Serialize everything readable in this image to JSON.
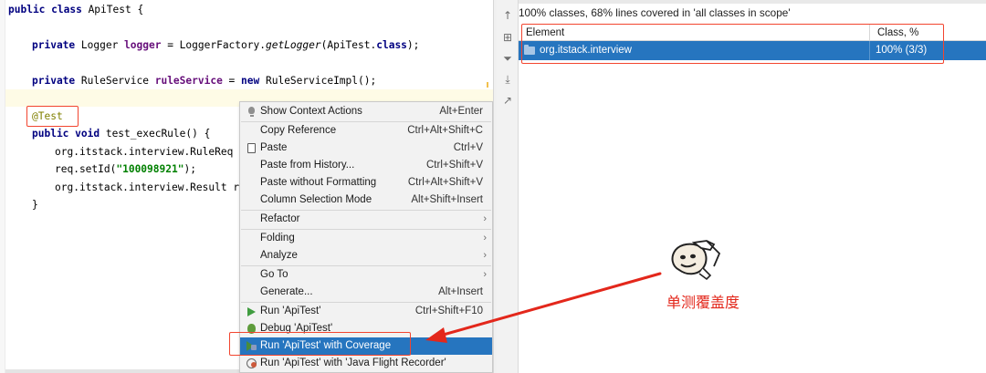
{
  "editor": {
    "code_lines": {
      "l1": {
        "kw": "public class",
        "rest": " ApiTest {"
      },
      "l2": {
        "kw": "private",
        "type": " Logger ",
        "field": "logger",
        "eq": " = LoggerFactory.",
        "method": "getLogger",
        "arg": "(ApiTest.",
        "kw2": "class",
        "end": ");"
      },
      "l3": {
        "kw": "private",
        "type": " RuleService ",
        "field": "ruleService",
        "eq": " = ",
        "kw2": "new",
        "rest": " RuleServiceImpl();"
      },
      "l4": {
        "annotation": "@Test"
      },
      "l5": {
        "kw": "public void",
        "rest": " test_execRule() {"
      },
      "l6": {
        "text": "org.itstack.interview.RuleReq req"
      },
      "l7": {
        "pre": "req.setId(",
        "str": "\"100098921\"",
        "post": ");"
      },
      "l8": {
        "text": "org.itstack.interview.Result resu"
      },
      "l9": {
        "text": "}"
      }
    }
  },
  "context_menu": {
    "items": [
      {
        "icon": "lightbulb-icon",
        "label": "Show Context Actions",
        "shortcut": "Alt+Enter"
      },
      {
        "icon": "",
        "label": "Copy Reference",
        "shortcut": "Ctrl+Alt+Shift+C"
      },
      {
        "icon": "clipboard-icon",
        "label": "Paste",
        "shortcut": "Ctrl+V"
      },
      {
        "icon": "",
        "label": "Paste from History...",
        "shortcut": "Ctrl+Shift+V"
      },
      {
        "icon": "",
        "label": "Paste without Formatting",
        "shortcut": "Ctrl+Alt+Shift+V"
      },
      {
        "icon": "",
        "label": "Column Selection Mode",
        "shortcut": "Alt+Shift+Insert"
      },
      {
        "icon": "",
        "label": "Refactor",
        "shortcut": ""
      },
      {
        "icon": "",
        "label": "Folding",
        "shortcut": ""
      },
      {
        "icon": "",
        "label": "Analyze",
        "shortcut": ""
      },
      {
        "icon": "",
        "label": "Go To",
        "shortcut": ""
      },
      {
        "icon": "",
        "label": "Generate...",
        "shortcut": "Alt+Insert"
      },
      {
        "icon": "run-icon",
        "label": "Run 'ApiTest'",
        "shortcut": "Ctrl+Shift+F10"
      },
      {
        "icon": "debug-icon",
        "label": "Debug 'ApiTest'",
        "shortcut": ""
      },
      {
        "icon": "coverage-icon",
        "label": "Run 'ApiTest' with Coverage",
        "shortcut": ""
      },
      {
        "icon": "flight-recorder-icon",
        "label": "Run 'ApiTest' with 'Java Flight Recorder'",
        "shortcut": ""
      }
    ],
    "selected_index": 13
  },
  "coverage": {
    "summary": "100% classes, 68% lines covered in 'all classes in scope'",
    "columns": {
      "element": "Element",
      "class_pct": "Class, %"
    },
    "rows": [
      {
        "element": "org.itstack.interview",
        "class_pct": "100% (3/3)"
      }
    ],
    "toolbar_icons": [
      "arrow-up-icon",
      "flatten-packages-icon",
      "filter-icon",
      "import-icon",
      "export-icon"
    ]
  },
  "annotation": {
    "label": "单测覆盖度",
    "color": "#e3271b"
  },
  "colors": {
    "selection": "#2675bf",
    "highlight_box": "#f2452f"
  }
}
